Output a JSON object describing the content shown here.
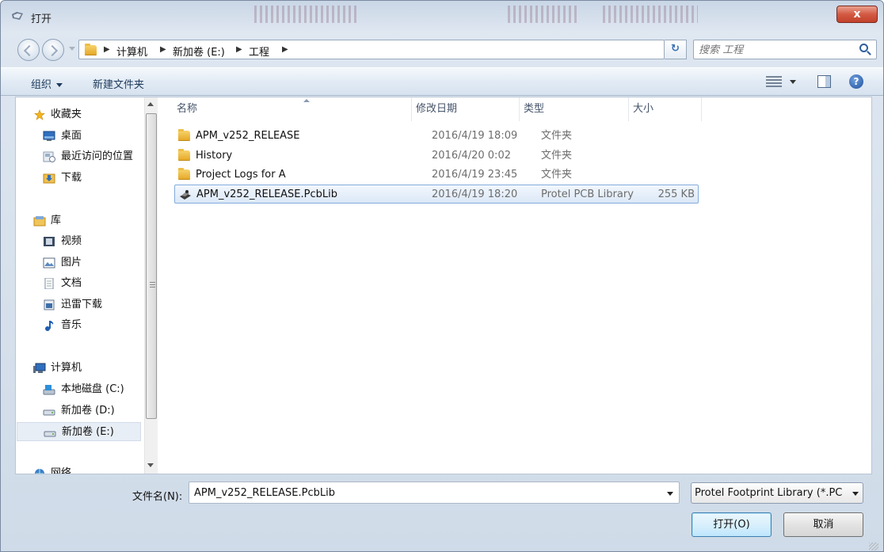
{
  "window": {
    "title": "打开",
    "close_label": "x"
  },
  "address": {
    "crumbs": [
      "计算机",
      "新加卷 (E:)",
      "工程"
    ]
  },
  "search": {
    "placeholder": "搜索 工程"
  },
  "toolbar": {
    "organize": "组织",
    "new_folder": "新建文件夹",
    "help": "?"
  },
  "nav": {
    "favorites": "收藏夹",
    "desktop": "桌面",
    "recent": "最近访问的位置",
    "downloads": "下载",
    "libraries": "库",
    "videos": "视频",
    "pictures": "图片",
    "documents": "文档",
    "xunlei": "迅雷下载",
    "music": "音乐",
    "computer": "计算机",
    "drive_c": "本地磁盘 (C:)",
    "drive_d": "新加卷 (D:)",
    "drive_e": "新加卷 (E:)",
    "network": "网络"
  },
  "columns": {
    "name": "名称",
    "date": "修改日期",
    "type": "类型",
    "size": "大小"
  },
  "files": [
    {
      "name": "APM_v252_RELEASE",
      "date": "2016/4/19 18:09",
      "type": "文件夹",
      "size": "",
      "icon": "folder-icon"
    },
    {
      "name": "History",
      "date": "2016/4/20 0:02",
      "type": "文件夹",
      "size": "",
      "icon": "folder-icon"
    },
    {
      "name": "Project Logs for A",
      "date": "2016/4/19 23:45",
      "type": "文件夹",
      "size": "",
      "icon": "folder-icon"
    },
    {
      "name": "APM_v252_RELEASE.PcbLib",
      "date": "2016/4/19 18:20",
      "type": "Protel PCB Library",
      "size": "255 KB",
      "icon": "pcblib-file-icon",
      "selected": true
    }
  ],
  "footer": {
    "filename_label": "文件名(N):",
    "filename_value": "APM_v252_RELEASE.PcbLib",
    "filetype_value": "Protel Footprint Library (*.PC",
    "open_label": "打开(O)",
    "cancel_label": "取消"
  },
  "colors": {
    "accent": "#3c7fb1",
    "selection": "#dbe8f7",
    "close": "#c2412b"
  }
}
